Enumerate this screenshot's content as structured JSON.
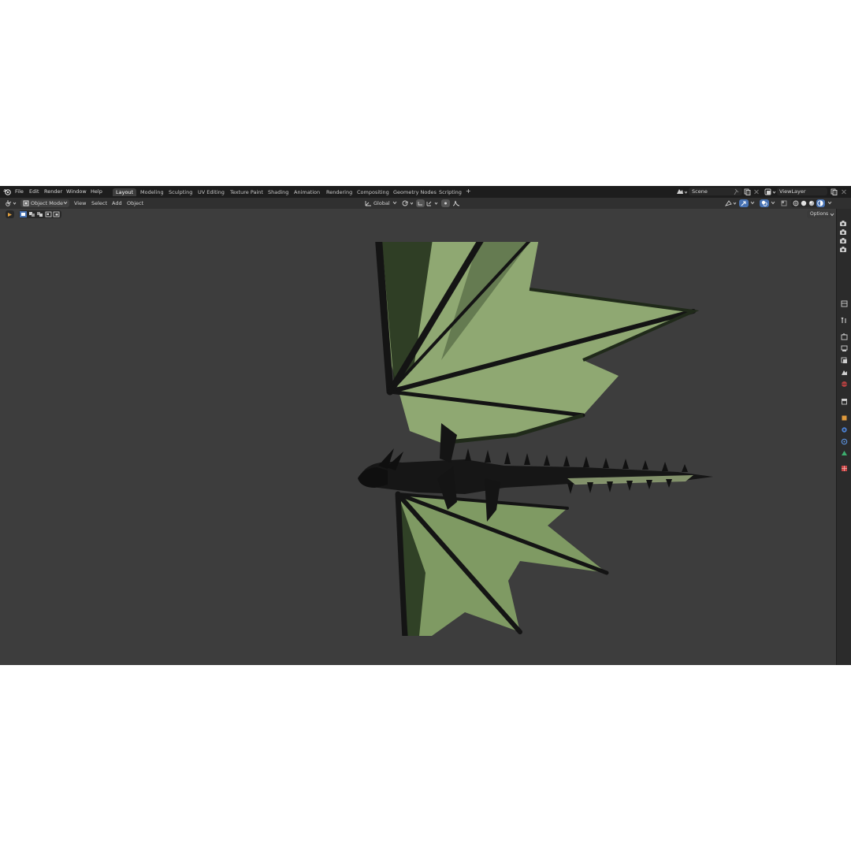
{
  "menu": {
    "items": [
      "File",
      "Edit",
      "Render",
      "Window",
      "Help"
    ]
  },
  "workspaces": {
    "tabs": [
      "Layout",
      "Modeling",
      "Sculpting",
      "UV Editing",
      "Texture Paint",
      "Shading",
      "Animation",
      "Rendering",
      "Compositing",
      "Geometry Nodes",
      "Scripting"
    ],
    "active": "Layout",
    "add_symbol": "+"
  },
  "scene": {
    "name": "Scene"
  },
  "view_layer": {
    "name": "ViewLayer"
  },
  "header": {
    "mode": "Object Mode",
    "menus": [
      "View",
      "Select",
      "Add",
      "Object"
    ],
    "transform_orientation": "Global"
  },
  "toolbar": {
    "options_label": "Options"
  },
  "colors": {
    "topbar_bg": "#1d1d1d",
    "header_bg": "#303030",
    "viewport_bg": "#3d3d3d",
    "accent_blue": "#4772b3",
    "wing_membrane": "#8fa872",
    "dragon_body": "#151515"
  },
  "icons": {
    "blender_logo": "blender-logo-icon",
    "editor_type": "3d-viewport-icon",
    "object_mode": "object-mode-icon",
    "pivot": "pivot-point-icon",
    "snap": "snap-icon",
    "proportional": "proportional-editing-icon",
    "shading": "viewport-shading-icon"
  }
}
